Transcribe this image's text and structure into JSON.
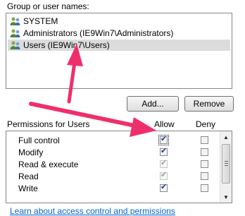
{
  "group_section": {
    "label": "Group or user names:",
    "users": [
      {
        "name": "SYSTEM",
        "selected": false
      },
      {
        "name": "Administrators (IE9Win7\\Administrators)",
        "selected": false
      },
      {
        "name": "Users (IE9Win7\\Users)",
        "selected": true
      }
    ]
  },
  "buttons": {
    "add": "Add...",
    "remove": "Remove"
  },
  "permissions": {
    "header_label": "Permissions for Users",
    "allow_label": "Allow",
    "deny_label": "Deny",
    "rows": [
      {
        "name": "Full control",
        "allow": "checked",
        "deny": "unchecked"
      },
      {
        "name": "Modify",
        "allow": "checked",
        "deny": "unchecked"
      },
      {
        "name": "Read & execute",
        "allow": "checked-disabled",
        "deny": "unchecked"
      },
      {
        "name": "Read",
        "allow": "checked-disabled",
        "deny": "unchecked"
      },
      {
        "name": "Write",
        "allow": "checked",
        "deny": "unchecked"
      }
    ]
  },
  "link": {
    "text": "Learn about access control and permissions"
  },
  "colors": {
    "annotation_arrow": "#ef2f6b",
    "link": "#0066cc",
    "selection": "#dcdcdc"
  },
  "icons": {
    "user_group": "users-group-icon",
    "scroll_up": "scroll-up-arrow-icon",
    "scroll_down": "scroll-down-arrow-icon"
  }
}
